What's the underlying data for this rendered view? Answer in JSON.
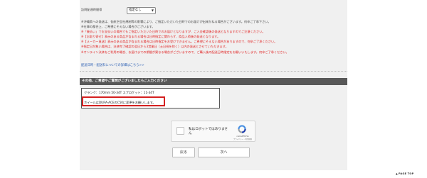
{
  "delivery": {
    "label": "訪問配達時間帯",
    "select_value": "指定なし"
  },
  "notes": [
    {
      "text": "※沖縄県への発送は、各航空会社規制等の影響により、ご指定いただいた日時でのお届けが出来かねる場合がございます。何卒ご了承下さい。",
      "color": "black"
    },
    {
      "text": "※在庫の都合上、ご希望にそえない場合がございます。",
      "color": "black"
    },
    {
      "text": "※「後払い」でお支払いの場合でもご指定いただいた日時でのお届けとなりますが、ご入金確認後の発送となりますのでご注意ください。",
      "color": "red"
    },
    {
      "text": "※【お取り寄せ】表示のある商品が含まれる場合は日時指定に関わらず、商品入荷後の発送となります。",
      "color": "red"
    },
    {
      "text": "※【メーカー直送】表示のある商品が含まれる場合は日時指定をお受けできません。ご希望にそえない場合がありますので、何卒ご了承ください。",
      "color": "red"
    },
    {
      "text": "※指定日が無い場合は、決済完了確認の翌日から3営業日（土日祝を除く）以内の発送とさせていただきます。",
      "color": "red"
    },
    {
      "text": "※オンライン決済をご利用の場合、お届けまでの期間が異なる場合がございますので、ご購入後の配送日時指定をお願いいたします。何卒ご了承ください。",
      "color": "red"
    }
  ],
  "delivery_link": "配送日時・配送料についての詳細はこちら>>",
  "section": {
    "header": "その他、ご希望やご質問がございましたらご入力ください",
    "comment_line1": "クランク：170mm 50-34T スプロケット：11-34T",
    "comment_line2": "ホイールはDURA-ACEのC50に変更をお願いします。"
  },
  "captcha": {
    "label": "私はロボットではありません",
    "brand": "reCAPTCHA",
    "terms": "プライバシー - 利用規約"
  },
  "buttons": {
    "back": "戻る",
    "next": "次へ"
  },
  "page_top": "PAGE TOP",
  "colors": {
    "panel_bg": "#f0f0f0",
    "header_bg": "#585858",
    "red_text": "#e02020",
    "link": "#2b5fb3",
    "highlight_border": "#d42020"
  }
}
